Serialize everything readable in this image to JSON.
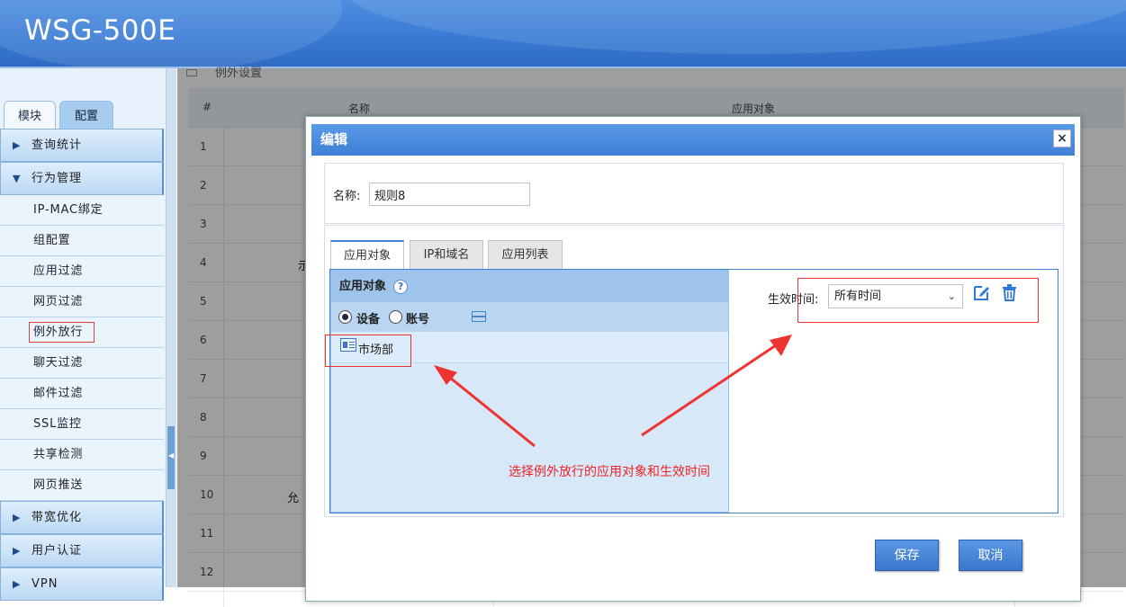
{
  "app": {
    "title": "WSG-500E"
  },
  "sidebar": {
    "tabs": [
      {
        "label": "模块"
      },
      {
        "label": "配置"
      }
    ],
    "sections": [
      {
        "label": "查询统计",
        "expanded": false
      },
      {
        "label": "行为管理",
        "expanded": true
      },
      {
        "label": "带宽优化",
        "expanded": false
      },
      {
        "label": "用户认证",
        "expanded": false
      },
      {
        "label": "VPN",
        "expanded": false
      }
    ],
    "items": [
      {
        "label": "IP-MAC绑定"
      },
      {
        "label": "组配置"
      },
      {
        "label": "应用过滤"
      },
      {
        "label": "网页过滤"
      },
      {
        "label": "例外放行",
        "selected": true
      },
      {
        "label": "聊天过滤"
      },
      {
        "label": "邮件过滤"
      },
      {
        "label": "SSL监控"
      },
      {
        "label": "共享检测"
      },
      {
        "label": "网页推送"
      }
    ]
  },
  "main": {
    "breadcrumb": "例外设置",
    "table": {
      "columns": [
        "#",
        "名称",
        "应用对象"
      ],
      "rows": [
        "1",
        "2",
        "3",
        "4",
        "5",
        "6",
        "7",
        "8",
        "9",
        "10",
        "11",
        "12"
      ],
      "partial_cells": [
        {
          "row": "4",
          "text": "示"
        },
        {
          "row": "10",
          "text": "允"
        }
      ]
    }
  },
  "modal": {
    "title": "编辑",
    "close_label": "×",
    "name_label": "名称:",
    "name_value": "规则8",
    "tabs": [
      {
        "label": "应用对象"
      },
      {
        "label": "IP和域名"
      },
      {
        "label": "应用列表"
      }
    ],
    "active_tab": "应用对象",
    "panel": {
      "header": "应用对象",
      "help_glyph": "?",
      "radios": [
        {
          "label": "设备",
          "checked": true
        },
        {
          "label": "账号",
          "checked": false
        }
      ],
      "entries": [
        {
          "label": "市场部"
        }
      ]
    },
    "time": {
      "label": "生效时间:",
      "selected": "所有时间"
    },
    "buttons": {
      "save": "保存",
      "cancel": "取消"
    }
  },
  "annotation": {
    "text": "选择例外放行的应用对象和生效时间",
    "color": "#e22222"
  },
  "colors": {
    "header_blue": "#3a7bd5",
    "accent_blue": "#3f7fd6",
    "annotation_red": "#e22222"
  }
}
